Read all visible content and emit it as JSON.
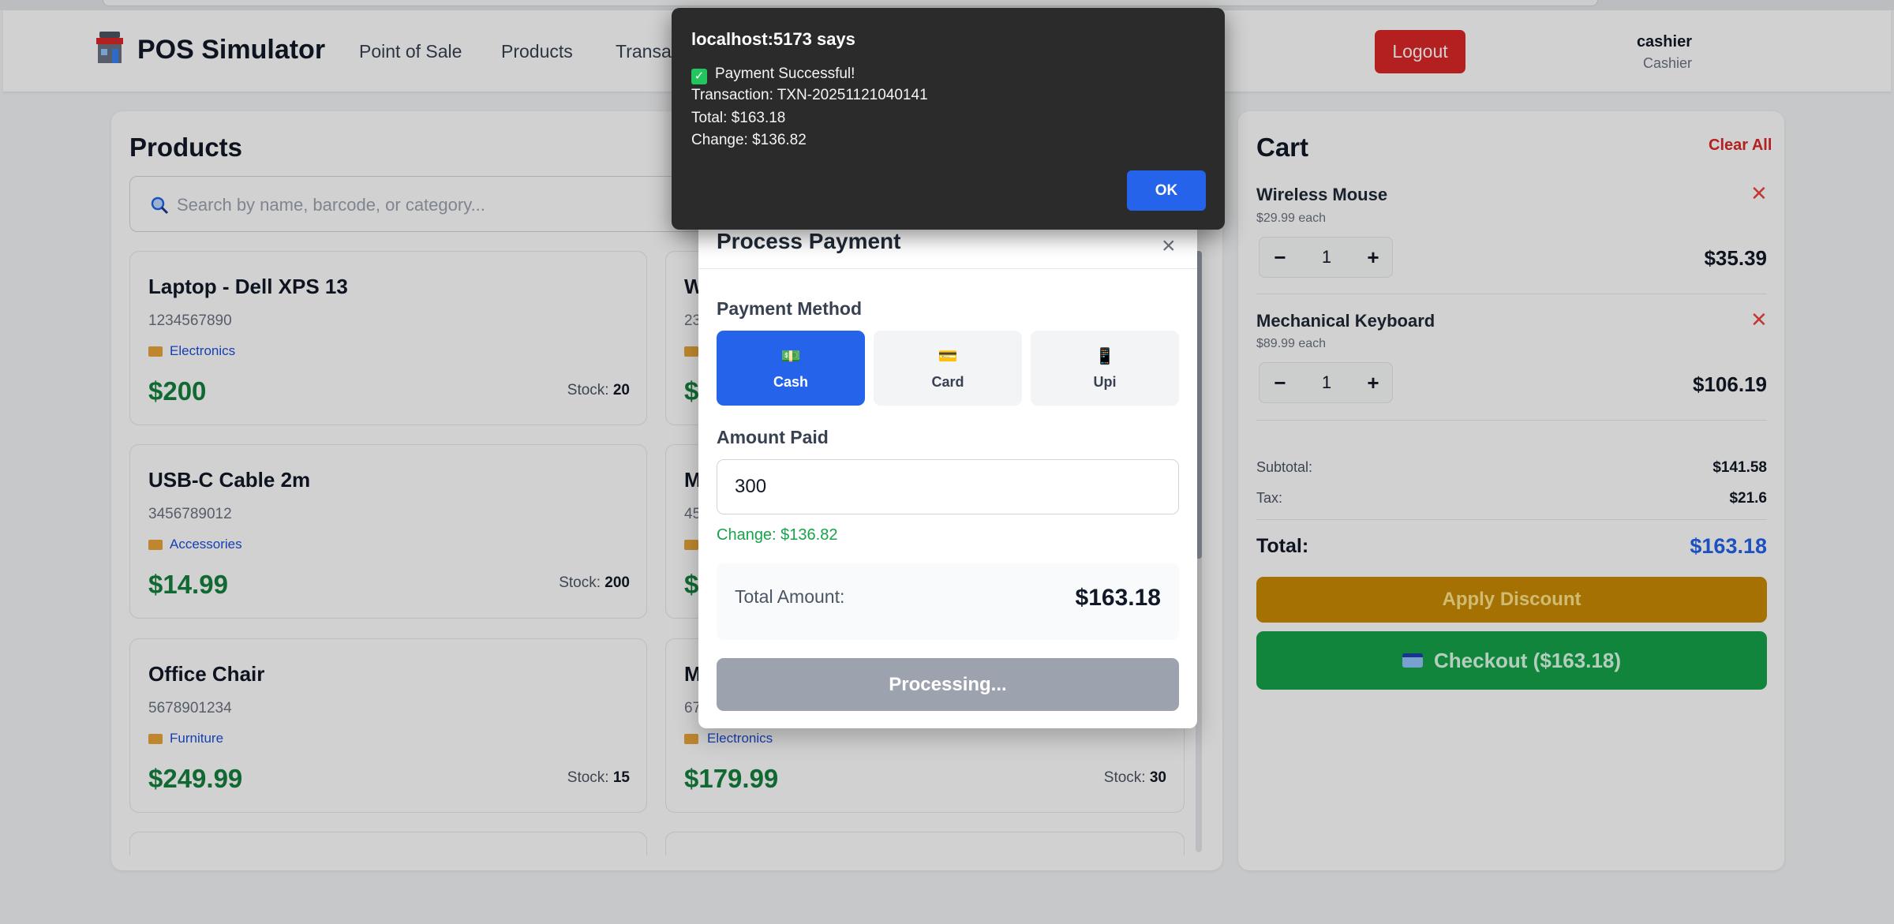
{
  "header": {
    "brand": "POS Simulator",
    "nav": [
      "Point of Sale",
      "Products",
      "Transac"
    ],
    "user_name": "cashier",
    "user_role": "Cashier",
    "logout_label": "Logout"
  },
  "products": {
    "title": "Products",
    "search_placeholder": "Search by name, barcode, or category...",
    "items": [
      {
        "name": "Laptop - Dell XPS 13",
        "barcode": "1234567890",
        "category": "Electronics",
        "price": "$200",
        "stock_label": "Stock:",
        "stock": "20"
      },
      {
        "name": "W",
        "barcode": "23",
        "category": "",
        "price": "$",
        "stock_label": "",
        "stock": ""
      },
      {
        "name": "USB-C Cable 2m",
        "barcode": "3456789012",
        "category": "Accessories",
        "price": "$14.99",
        "stock_label": "Stock:",
        "stock": "200"
      },
      {
        "name": "M",
        "barcode": "45",
        "category": "",
        "price": "$",
        "stock_label": "",
        "stock": ""
      },
      {
        "name": "Office Chair",
        "barcode": "5678901234",
        "category": "Furniture",
        "price": "$249.99",
        "stock_label": "Stock:",
        "stock": "15"
      },
      {
        "name": "M",
        "barcode": "67",
        "category": "Electronics",
        "price": "$179.99",
        "stock_label": "Stock:",
        "stock": "30"
      }
    ]
  },
  "cart": {
    "title": "Cart",
    "clear_label": "Clear All",
    "items": [
      {
        "name": "Wireless Mouse",
        "unit": "$29.99 each",
        "qty": "1",
        "total": "$35.39"
      },
      {
        "name": "Mechanical Keyboard",
        "unit": "$89.99 each",
        "qty": "1",
        "total": "$106.19"
      }
    ],
    "subtotal_label": "Subtotal:",
    "subtotal": "$141.58",
    "tax_label": "Tax:",
    "tax": "$21.6",
    "total_label": "Total:",
    "total": "$163.18",
    "discount_label": "Apply Discount",
    "checkout_label": "Checkout ($163.18)"
  },
  "modal": {
    "title": "Process Payment",
    "close": "×",
    "method_label": "Payment Method",
    "methods": [
      {
        "label": "Cash",
        "icon": "cash-icon",
        "glyph": "💵"
      },
      {
        "label": "Card",
        "icon": "card-icon",
        "glyph": "💳"
      },
      {
        "label": "Upi",
        "icon": "phone-icon",
        "glyph": "📱"
      }
    ],
    "amount_label": "Amount Paid",
    "amount_value": "300",
    "change_text": "Change: $136.82",
    "total_label": "Total Amount:",
    "total_value": "$163.18",
    "processing_label": "Processing..."
  },
  "alert": {
    "title": "localhost:5173 says",
    "line1": "Payment Successful!",
    "line2": "Transaction: TXN-20251121040141",
    "line3": "Total: $163.18",
    "line4": "Change: $136.82",
    "ok_label": "OK"
  },
  "colors": {
    "accent": "#2563eb",
    "success": "#16a34a",
    "danger": "#dc2626",
    "warning": "#ca8a04"
  }
}
